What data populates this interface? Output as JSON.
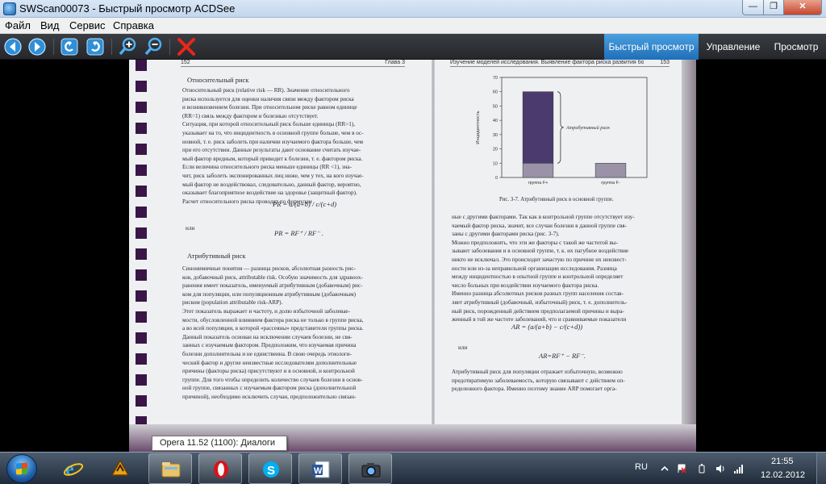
{
  "window": {
    "title": "SWScan00073 - Быстрый просмотр ACDSee",
    "min_label": "—",
    "max_label": "❐",
    "close_label": "✕"
  },
  "menu": [
    "Файл",
    "Вид",
    "Сервис",
    "Справка"
  ],
  "toolbar": {
    "icons": [
      "back-icon",
      "forward-icon",
      "rotate-left-icon",
      "rotate-right-icon",
      "zoom-in-icon",
      "zoom-out-icon",
      "delete-icon"
    ],
    "modes": [
      "Быстрый просмотр",
      "Управление",
      "Просмотр"
    ],
    "accent": "#1f6fb8"
  },
  "scan": {
    "left_header_num": "152",
    "left_header_chap": "Глава 3",
    "right_header": "Изучение моделей исследования. Выявление фактора риска развития болезней",
    "right_header_num": "153",
    "left_heading1": "Относительный риск",
    "left_lines_1": [
      "Относительный риск (relative risk — RR). Значение относительного",
      "риска используется для оценки наличия связи между фактором риска",
      "и возникновением болезни. При относительном риске равном единице",
      "(RR=1) связь между фактором и болезнью отсутствует.",
      "Ситуация, при которой относительный риск больше единицы (RR>1),",
      "указывает на то, что инцидентность в основной группе больше, чем в ос-",
      "новной, т. е. риск заболеть при наличии изучаемого фактора больше, чем",
      "при его отсутствии. Данные результаты дают основание считать изучае-",
      "мый фактор вредным, который приводит к болезни, т. е. фактором риска.",
      "Если величина относительного риска меньше единицы (RR <1), зна-",
      "чит, риск заболеть экспонированных лиц ниже, чем у тех, на кого изучае-",
      "мый фактор не воздействовал, следовательно, данный фактор, вероятно,",
      "оказывает благоприятное воздействие на здоровье (защитный фактор).",
      "Расчет относительного риска проводят по формулам"
    ],
    "formula1": "PR = a/(a+b) / c/(c+d)",
    "or_label": "или",
    "formula2": "PR = RF⁺ / RF⁻ .",
    "left_heading2": "Атрибутивный риск",
    "left_lines_2": [
      "Синонимичные понятия — разница рисков, абсолютная разность рис-",
      "ков, добавочный риск, attributable risk. Особую значимость для здравоох-",
      "ранения имеет показатель, именуемый атрибутивным (добавочным) рис-",
      "ком для популяции, или популяционным атрибутивным (добавочным)",
      "риском (population attributable risk-ARP).",
      "Этот показатель выражает и частоту, и долю избыточной заболевае-",
      "мости, обусловленной влиянием фактора риска не только в группе риска,",
      "а во всей популяции, в которой «рассеяны» представители группы риска.",
      "Данный показатель основан на исключении случаев болезни, не свя-",
      "занных с изучаемым фактором. Предположим, что изучаемая причина",
      "болезни дополнительна и не единственна. В свою очередь этиологи-",
      "ческий фактор и другие неизвестные исследователям дополнительные",
      "причины (факторы риска) присутствуют и в основной, и контрольной",
      "группе. Для того чтобы определить количество случаев болезни в основ-",
      "ной группе, связанных с изучаемым фактором риска (дополнительной",
      "причиной), необходимо исключить случаи, предположительно связан-"
    ],
    "caption": "Рис. 3-7. Атрибутивный риск в основной группе.",
    "right_lines_1": [
      "ные с другими факторами. Так как в контрольной группе отсутствует изу-",
      "чаемый фактор риска, значит, все случаи болезни в данной группе свя-",
      "заны с другими факторами риска (рис. 3-7).",
      "Можно предположить, что эти же факторы с такой же частотой вы-",
      "зывают заболевания и в основной группе, т. к. их пагубное воздействие",
      "никто не исключал. Это происходит зачастую по причине их неизвест-",
      "ности или из-за неправильной организации исследования. Разница",
      "между инцидентностью в опытной группе и контрольной определяет",
      "число больных при воздействии изучаемого фактора риска.",
      "Именно разница абсолютных рисков разных групп населения состав-",
      "ляет атрибутивный (добавочный, избыточный) риск, т. е. дополнитель-",
      "ный риск, порожденный действием предполагаемой причины и выра-",
      "женный в той же частоте заболеваний, что и сравниваемые показатели"
    ],
    "formula3": "AR = (a/(a+b) − c/(c+d))",
    "or_label2": "или",
    "formula4": "AR=RF⁺ − RF⁻.",
    "right_lines_2": [
      "Атрибутивный риск для популяции отражает избыточную, возможно",
      "предотвратимую заболеваемость, которую связывают с действием оп-",
      "ределенного фактора. Именно поэтому знание ARP помогает орга-"
    ]
  },
  "chart_data": {
    "type": "bar",
    "categories": [
      "группа F+",
      "группа F-"
    ],
    "series": [
      {
        "values": [
          10,
          10
        ]
      },
      {
        "values": [
          50,
          0
        ]
      }
    ],
    "ylabel": "Инцидентность",
    "ylim": [
      0,
      70
    ],
    "yticks": [
      "0",
      "10",
      "20",
      "30",
      "40",
      "50",
      "60",
      "70"
    ],
    "annotation": "Атрибутивный риск",
    "colors": {
      "base": "#9a93a8",
      "attributable": "#4a3a6e"
    }
  },
  "tooltip": "Opera 11.52 (1100): Диалоги",
  "taskbar": {
    "items": [
      {
        "name": "internet-explorer-icon",
        "running": false
      },
      {
        "name": "winamp-icon",
        "running": false
      },
      {
        "name": "explorer-folder-icon",
        "running": true
      },
      {
        "name": "opera-icon",
        "running": true
      },
      {
        "name": "skype-icon",
        "running": true
      },
      {
        "name": "word-icon",
        "running": true
      },
      {
        "name": "acdsee-icon",
        "running": true
      }
    ],
    "lang": "RU",
    "time": "21:55",
    "date": "12.02.2012"
  }
}
